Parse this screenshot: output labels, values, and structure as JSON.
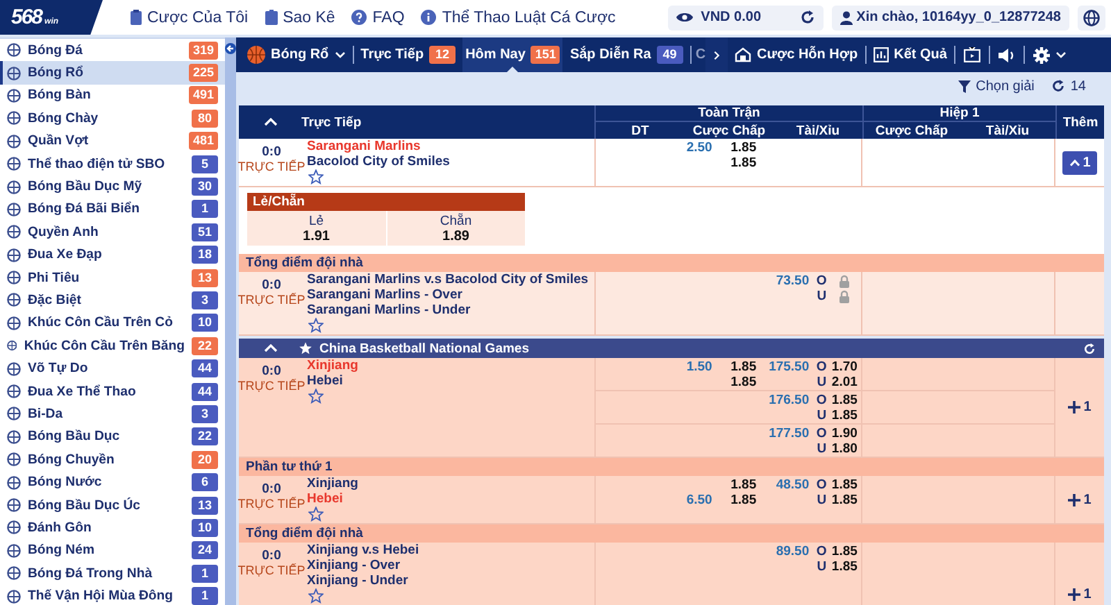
{
  "logo": {
    "text": "568",
    "suffix": "win"
  },
  "top_links": [
    {
      "label": "Cược Của Tôi"
    },
    {
      "label": "Sao Kê"
    },
    {
      "label": "FAQ"
    },
    {
      "label": "Thể Thao Luật Cá Cược"
    }
  ],
  "balance": "VND 0.00",
  "greeting": "Xin chào, 10164yy_0_12877248",
  "sidebar": [
    {
      "label": "Bóng Đá",
      "count": "319",
      "color": "#f0714a",
      "selected": false
    },
    {
      "label": "Bóng Rổ",
      "count": "225",
      "color": "#f0714a",
      "selected": true
    },
    {
      "label": "Bóng Bàn",
      "count": "491",
      "color": "#f0714a",
      "selected": false
    },
    {
      "label": "Bóng Chày",
      "count": "80",
      "color": "#f0714a",
      "selected": false
    },
    {
      "label": "Quần Vợt",
      "count": "481",
      "color": "#f0714a",
      "selected": false
    },
    {
      "label": "Thể thao điện tử SBO",
      "count": "5",
      "color": "#4a5bbf",
      "selected": false
    },
    {
      "label": "Bóng Bầu Dục Mỹ",
      "count": "30",
      "color": "#4a5bbf",
      "selected": false
    },
    {
      "label": "Bóng Đá Bãi Biển",
      "count": "1",
      "color": "#4a5bbf",
      "selected": false
    },
    {
      "label": "Quyền Anh",
      "count": "51",
      "color": "#4a5bbf",
      "selected": false
    },
    {
      "label": "Đua Xe Đạp",
      "count": "18",
      "color": "#4a5bbf",
      "selected": false
    },
    {
      "label": "Phi Tiêu",
      "count": "13",
      "color": "#f0714a",
      "selected": false
    },
    {
      "label": "Đặc Biệt",
      "count": "3",
      "color": "#4a5bbf",
      "selected": false
    },
    {
      "label": "Khúc Côn Cầu Trên Cỏ",
      "count": "10",
      "color": "#4a5bbf",
      "selected": false
    },
    {
      "label": "Khúc Côn Cầu Trên Băng",
      "count": "22",
      "color": "#f0714a",
      "selected": false
    },
    {
      "label": "Võ Tự Do",
      "count": "44",
      "color": "#4a5bbf",
      "selected": false
    },
    {
      "label": "Đua Xe Thể Thao",
      "count": "44",
      "color": "#4a5bbf",
      "selected": false
    },
    {
      "label": "Bi-Da",
      "count": "3",
      "color": "#4a5bbf",
      "selected": false
    },
    {
      "label": "Bóng Bầu Dục",
      "count": "22",
      "color": "#4a5bbf",
      "selected": false
    },
    {
      "label": "Bóng Chuyền",
      "count": "20",
      "color": "#f0714a",
      "selected": false
    },
    {
      "label": "Bóng Nước",
      "count": "6",
      "color": "#4a5bbf",
      "selected": false
    },
    {
      "label": "Bóng Bầu Dục Úc",
      "count": "13",
      "color": "#4a5bbf",
      "selected": false
    },
    {
      "label": "Đánh Gôn",
      "count": "10",
      "color": "#4a5bbf",
      "selected": false
    },
    {
      "label": "Bóng Ném",
      "count": "24",
      "color": "#4a5bbf",
      "selected": false
    },
    {
      "label": "Bóng Đá Trong Nhà",
      "count": "1",
      "color": "#4a5bbf",
      "selected": false
    },
    {
      "label": "Thế Vận Hội Mùa Đông",
      "count": "1",
      "color": "#4a5bbf",
      "selected": false
    }
  ],
  "sport_menu": {
    "label": "Bóng Rổ"
  },
  "tabs": [
    {
      "label": "Trực Tiếp",
      "count": "12",
      "color": "#f0714a",
      "selected": false
    },
    {
      "label": "Hôm Nay",
      "count": "151",
      "color": "#f0714a",
      "selected": true
    },
    {
      "label": "Sắp Diễn Ra",
      "count": "49",
      "color": "#4a5bbf",
      "selected": false
    }
  ],
  "cut_tab": "C",
  "toolbar": [
    {
      "label": "Cược Hỗn Hợp"
    },
    {
      "label": "Kết Quả"
    }
  ],
  "filter": {
    "label": "Chọn giải"
  },
  "refresh_count": "14",
  "table": {
    "live_label": "Trực Tiếp",
    "groups": [
      {
        "label": "Toàn Trận",
        "columns": [
          "DT",
          "Cược Chấp",
          "Tài/Xỉu"
        ]
      },
      {
        "label": "Hiệp 1",
        "columns": [
          "Cược Chấp",
          "Tài/Xỉu"
        ]
      }
    ],
    "more_label": "Thêm",
    "blocks": [
      {
        "kind": "match",
        "score": "0:0",
        "status": "TRỰC TIẾP",
        "teams": [
          {
            "name": "Sarangani Marlins",
            "favorite": true
          },
          {
            "name": "Bacolod City of Smiles",
            "favorite": false
          }
        ],
        "lines": [
          {
            "hdp": "2.50",
            "hdp_odds": [
              "1.85",
              "1.85"
            ]
          }
        ],
        "more": {
          "label": "1",
          "expanded": true
        }
      },
      {
        "kind": "odd_even",
        "title": "Lẻ/Chẵn",
        "options": [
          {
            "label": "Lẻ",
            "odds": "1.91"
          },
          {
            "label": "Chẵn",
            "odds": "1.89"
          }
        ]
      },
      {
        "kind": "section",
        "title": "Tổng điểm đội nhà"
      },
      {
        "kind": "match",
        "score": "0:0",
        "status": "TRỰC TIẾP",
        "teams": [
          {
            "name": "Sarangani Marlins v.s Bacolod City of Smiles",
            "favorite": false
          },
          {
            "name": "Sarangani Marlins - Over",
            "favorite": false
          },
          {
            "name": "Sarangani Marlins - Under",
            "favorite": false
          }
        ],
        "lines": [
          {
            "ou": "73.50",
            "ou_sides": [
              "O",
              "U"
            ],
            "locked": true
          }
        ]
      },
      {
        "kind": "league",
        "title": "China Basketball National Games",
        "expanded": true
      },
      {
        "kind": "match",
        "score": "0:0",
        "status": "TRỰC TIẾP",
        "teams": [
          {
            "name": "Xinjiang",
            "favorite": true
          },
          {
            "name": "Hebei",
            "favorite": false
          }
        ],
        "lines": [
          {
            "hdp": "1.50",
            "hdp_odds": [
              "1.85",
              "1.85"
            ],
            "ou": "175.50",
            "ou_sides": [
              "O",
              "U"
            ],
            "ou_odds": [
              "1.70",
              "2.01"
            ]
          },
          {
            "ou": "176.50",
            "ou_sides": [
              "O",
              "U"
            ],
            "ou_odds": [
              "1.85",
              "1.85"
            ]
          },
          {
            "ou": "177.50",
            "ou_sides": [
              "O",
              "U"
            ],
            "ou_odds": [
              "1.90",
              "1.80"
            ]
          }
        ],
        "more": {
          "label": "1",
          "expanded": false
        }
      },
      {
        "kind": "section",
        "title": "Phần tư thứ 1"
      },
      {
        "kind": "match",
        "score": "0:0",
        "status": "TRỰC TIẾP",
        "teams": [
          {
            "name": "Xinjiang",
            "favorite": false
          },
          {
            "name": "Hebei",
            "favorite": true
          }
        ],
        "lines": [
          {
            "hdp": "6.50",
            "hdp_odds": [
              "1.85",
              "1.85"
            ],
            "ou": "48.50",
            "ou_sides": [
              "O",
              "U"
            ],
            "ou_odds": [
              "1.85",
              "1.85"
            ]
          }
        ],
        "more": {
          "label": "1",
          "expanded": false
        }
      },
      {
        "kind": "section",
        "title": "Tổng điểm đội nhà"
      },
      {
        "kind": "match",
        "score": "0:0",
        "status": "TRỰC TIẾP",
        "teams": [
          {
            "name": "Xinjiang v.s Hebei",
            "favorite": false
          },
          {
            "name": "Xinjiang - Over",
            "favorite": false
          },
          {
            "name": "Xinjiang - Under",
            "favorite": false
          }
        ],
        "lines": [
          {
            "ou": "89.50",
            "ou_sides": [
              "O",
              "U"
            ],
            "ou_odds": [
              "1.85",
              "1.85"
            ]
          }
        ],
        "more": {
          "label": "1",
          "expanded": false
        }
      }
    ]
  }
}
